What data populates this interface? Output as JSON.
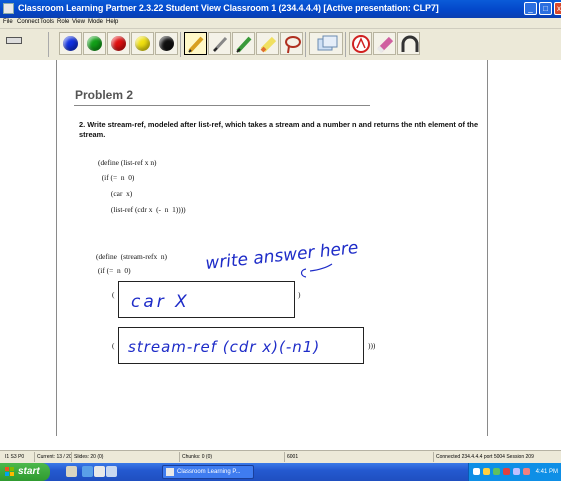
{
  "window": {
    "title": "Classroom Learning Partner 2.3.22  Student View   Classroom 1 (234.4.4.4)  [Active presentation: CLP7]",
    "buttons": [
      "_",
      "□",
      "x"
    ]
  },
  "menu": [
    "File",
    "Connect",
    "Tools",
    "Role",
    "View",
    "Mode",
    "Help"
  ],
  "toolbar": {
    "colors": [
      {
        "name": "blue",
        "hex": "#1030e0"
      },
      {
        "name": "green",
        "hex": "#12a018"
      },
      {
        "name": "red",
        "hex": "#e01010"
      },
      {
        "name": "yellow",
        "hex": "#f0e010"
      },
      {
        "name": "black",
        "hex": "#101010"
      }
    ],
    "tools": [
      "pen-icon",
      "thin-pen-icon",
      "highlighter-pen-icon",
      "marker-icon",
      "lasso-icon",
      "shapes-icon",
      "pdf-icon",
      "eraser-icon",
      "undo-arc-icon"
    ]
  },
  "slide": {
    "title": "Problem 2",
    "question": "2.  Write stream-ref, modeled after list-ref, which takes a stream and a number n and returns the nth element of the stream.",
    "code_list_ref": [
      "(define (list-ref x n)",
      "  (if (=  n  0)",
      "       (car  x)",
      "       (list-ref (cdr x  (-  n  1))))"
    ],
    "code_stream_ref": [
      "(define  (stream-refx  n)",
      " (if (=  n  0)"
    ],
    "paren_open_1": "(",
    "paren_close_1": ")",
    "paren_open_2": "(",
    "paren_close_2": ")))",
    "ink_prompt": "write answer here",
    "ink_answer_1": "car  X",
    "ink_answer_2": "stream-ref (cdr x)(-n1)"
  },
  "status": {
    "s1": "I1  S3  P0",
    "s2": "Current: 13 / 20",
    "s3": "Slides: 20 (0)",
    "s4": "Chunks: 0 (0)",
    "s5": "6001",
    "s6": "Connected 234.4.4.4 port 5004 Session 209"
  },
  "taskbar": {
    "start": "start",
    "task": "Classroom Learning P...",
    "clock": "4:41 PM"
  }
}
